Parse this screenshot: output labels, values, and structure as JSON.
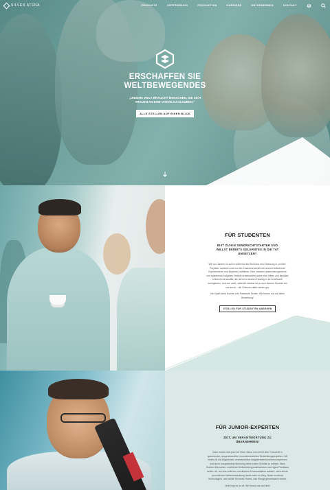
{
  "header": {
    "brand": "SILVER ATENA",
    "nav": [
      "PRODUKTE",
      "VERTRIEBUNG",
      "PRODUKTION",
      "KARRIERE",
      "UNTERNEHMEN",
      "KONTAKT"
    ],
    "icons": [
      "globe-icon",
      "search-icon"
    ]
  },
  "hero": {
    "title_line1": "ERSCHAFFEN SIE",
    "title_line2": "WELTBEWEGENDES",
    "quote": "„UNSERE WELT BRAUCHT MENSCHEN, DIE SICH TRAUEN AN EINE VISION ZU GLAUBEN.“",
    "button": "ALLE STELLEN AUF EINEN BLICK",
    "scroll_icon": "arrow-down-icon"
  },
  "students": {
    "title": "FÜR STUDENTEN",
    "lead": "BIST DU EIN SENKRECHTSTARTER UND WILLST BEREITS GELERNTES IN DIE TAT UMSETZEN?",
    "body": "Wir von Janeen du schon während des Studiums erst Erfahrung in „echten“ Projekten sammeln und von der Zusammenarbeit mit unseren erfahrenen Experteninnen und Experten profitieren. Dich erwarten abwechslungsreiche und spannende Aufgaben, flexible Arbeitszeiten sowie eine offene und familiäre Unternehmenskultur, die dir einen idealen Einstieg in die Arbeitswelt ermöglichen. Und wer weiß, vielleicht startest du ja nach deinem Studium bei uns durch – die Chancen dafür stehen gut.",
    "body2": "Viel Spaß beim Suchen und Passende Finden. Wir freuen uns auf deine Bewerbung!",
    "button": "STELLEN FÜR STUDENTEN ANSEHEN"
  },
  "juniors": {
    "title": "FÜR JUNIOR-EXPERTEN",
    "lead": "ZEIT, UM VERANTWORTUNG ZU ÜBERNEHMEN!",
    "body": "Dann bewirb dich jetzt bei Silver Atena und verhilf dem Fortschritt in spannenden, anspruchsvollen, innovationsreichen Entwicklungsprojekten. Wir bieten dir die Möglichkeit, verantwortliche Aufgabenbereiche kennenzulernen und durch kompetentes Mentoring deine ersten Schritte zu erleben. Beim Suchen Menschen, zuhörliche Weiterbildungsmaßnahmen und reges Feedback helfen, dir, auf einer offenen und direkten Kommunikation aufbaut, steht deiner persönlichen Weiterentwicklung nichts mehr im Weg. Nutze moderne Technologien, und werde Teil eines Teams, das Erfolge gemeinsam erreicht.",
    "body2": "Jetzt liegt es an dir. Wir freuen uns auf dich!"
  }
}
